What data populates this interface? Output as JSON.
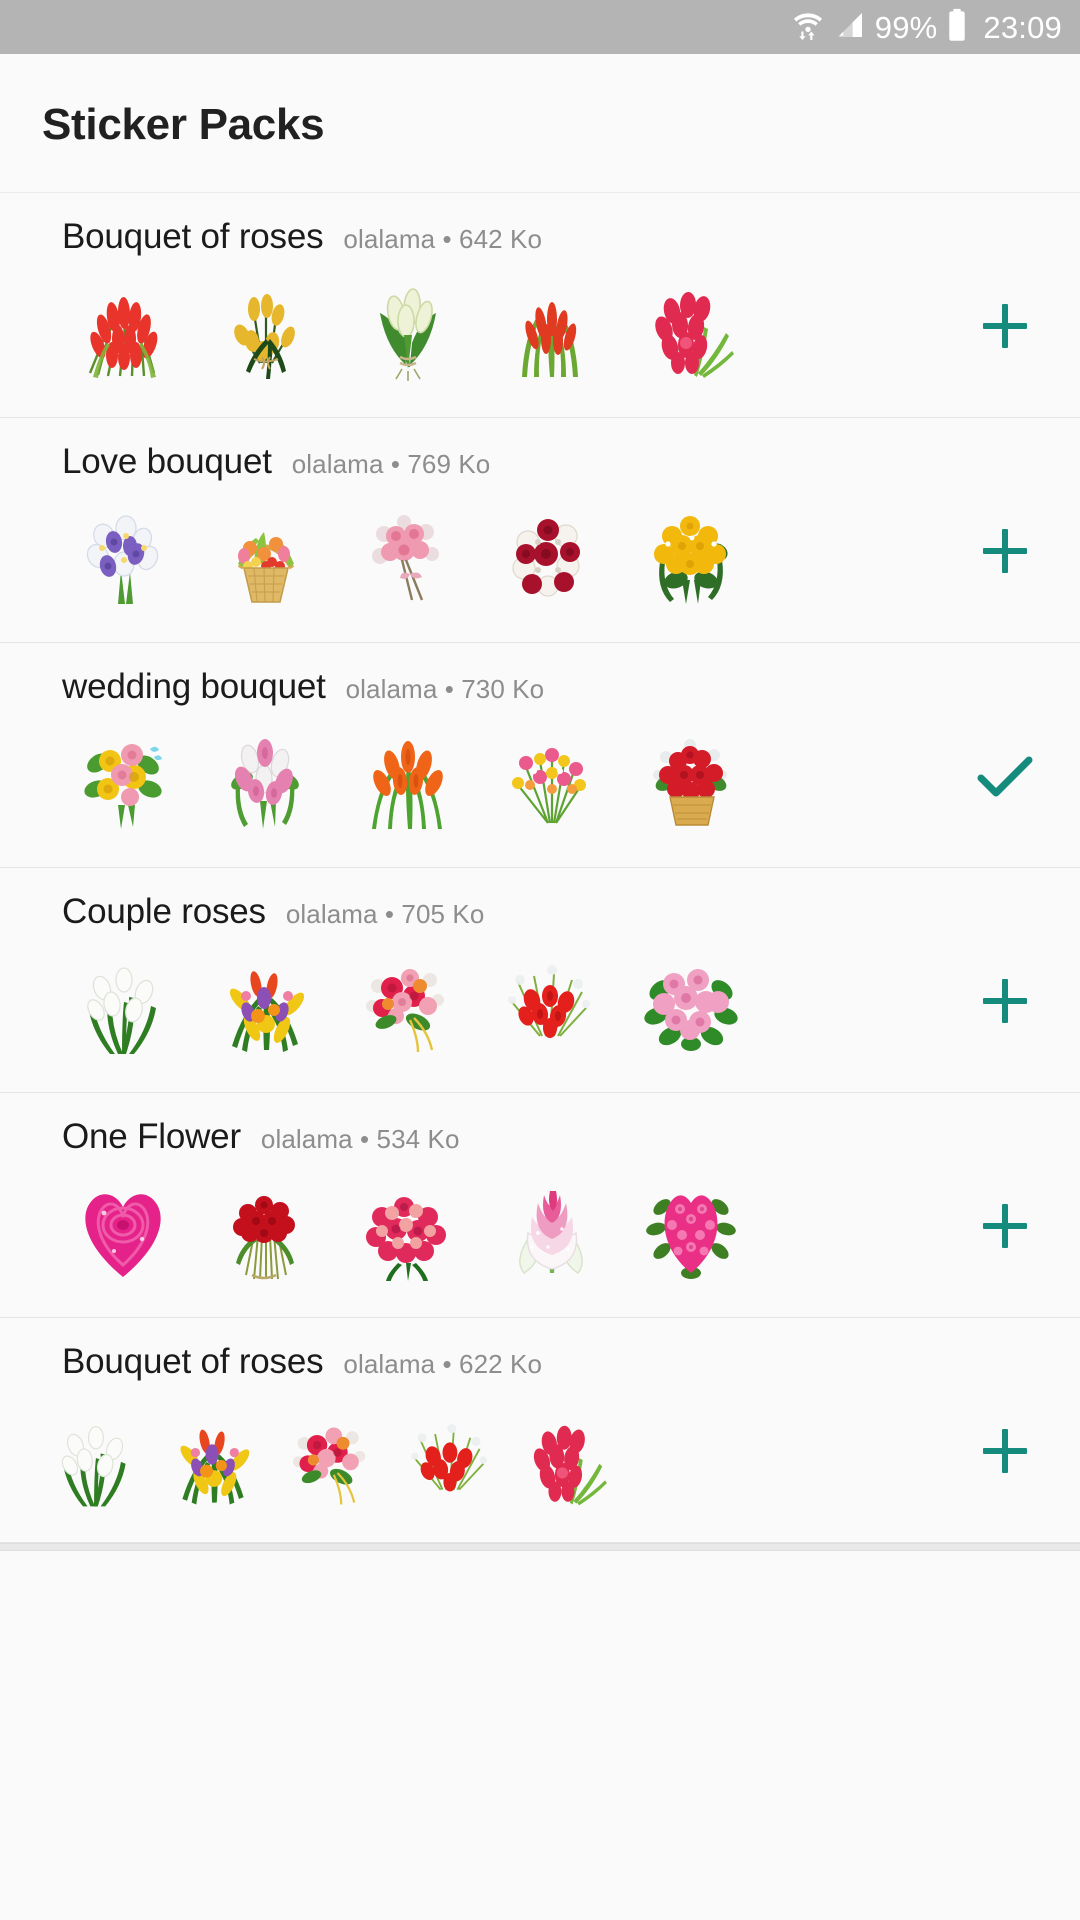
{
  "status_bar": {
    "wifi_icon": "wifi-transfer-icon",
    "signal_icon": "cellular-signal-icon",
    "battery_percent": "99%",
    "battery_icon": "battery-full-icon",
    "clock": "23:09",
    "background_color": "#b4b4b4",
    "text_color": "#ffffff"
  },
  "header": {
    "title": "Sticker Packs"
  },
  "theme": {
    "accent_color": "#148b7c",
    "page_background": "#fafafa",
    "title_color": "#212121",
    "meta_color": "#8d8d8d",
    "divider_color": "#e6e6e6"
  },
  "packs": [
    {
      "title": "Bouquet of roses",
      "author": "olalama",
      "separator": "•",
      "size": "642 Ko",
      "meta": "olalama • 642 Ko",
      "action": "add",
      "action_label": "+",
      "action_icon": "plus-icon",
      "stickers": [
        {
          "name": "red-tulip-spray-sticker"
        },
        {
          "name": "yellow-tulip-bundle-sticker"
        },
        {
          "name": "white-lily-bouquet-sticker"
        },
        {
          "name": "red-green-tulip-fan-sticker"
        },
        {
          "name": "pink-tulip-cluster-sticker"
        }
      ]
    },
    {
      "title": "Love bouquet",
      "author": "olalama",
      "separator": "•",
      "size": "769 Ko",
      "meta": "olalama • 769 Ko",
      "action": "add",
      "action_label": "+",
      "action_icon": "plus-icon",
      "stickers": [
        {
          "name": "white-purple-iris-bouquet-sticker"
        },
        {
          "name": "flower-basket-sticker"
        },
        {
          "name": "pink-rose-wrapped-bouquet-sticker"
        },
        {
          "name": "red-white-rose-bouquet-sticker"
        },
        {
          "name": "yellow-chrysanthemum-bouquet-sticker"
        }
      ]
    },
    {
      "title": "wedding bouquet",
      "author": "olalama",
      "separator": "•",
      "size": "730 Ko",
      "meta": "olalama • 730 Ko",
      "action": "installed",
      "action_label": "✓",
      "action_icon": "check-icon",
      "stickers": [
        {
          "name": "yellow-pink-rose-bouquet-sticker"
        },
        {
          "name": "pink-white-tulip-bouquet-sticker"
        },
        {
          "name": "orange-tulip-bouquet-sticker"
        },
        {
          "name": "mixed-pink-wildflower-sticker"
        },
        {
          "name": "red-carnation-basket-sticker"
        }
      ]
    },
    {
      "title": "Couple roses",
      "author": "olalama",
      "separator": "•",
      "size": "705 Ko",
      "meta": "olalama • 705 Ko",
      "action": "add",
      "action_label": "+",
      "action_icon": "plus-icon",
      "stickers": [
        {
          "name": "white-tulip-bouquet-sticker"
        },
        {
          "name": "tropical-mixed-bouquet-sticker"
        },
        {
          "name": "pink-rose-corsage-sticker"
        },
        {
          "name": "red-rose-spray-sticker"
        },
        {
          "name": "pink-rose-ball-sticker"
        }
      ]
    },
    {
      "title": "One Flower",
      "author": "olalama",
      "separator": "•",
      "size": "534 Ko",
      "meta": "olalama • 534 Ko",
      "action": "add",
      "action_label": "+",
      "action_icon": "plus-icon",
      "stickers": [
        {
          "name": "pink-heart-rose-sticker"
        },
        {
          "name": "red-rose-bunch-sticker"
        },
        {
          "name": "pink-red-rose-dome-sticker"
        },
        {
          "name": "pink-lotus-sticker"
        },
        {
          "name": "pink-carnation-heart-sticker"
        }
      ]
    },
    {
      "title": "Bouquet of roses",
      "author": "olalama",
      "separator": "•",
      "size": "622 Ko",
      "meta": "olalama • 622 Ko",
      "action": "add",
      "action_label": "+",
      "action_icon": "plus-icon",
      "stickers": [
        {
          "name": "white-tulip-bouquet-sticker"
        },
        {
          "name": "tropical-mixed-bouquet-sticker"
        },
        {
          "name": "pink-rose-corsage-sticker"
        },
        {
          "name": "red-rose-spray-sticker"
        },
        {
          "name": "red-tulip-cluster-sticker"
        }
      ]
    }
  ]
}
